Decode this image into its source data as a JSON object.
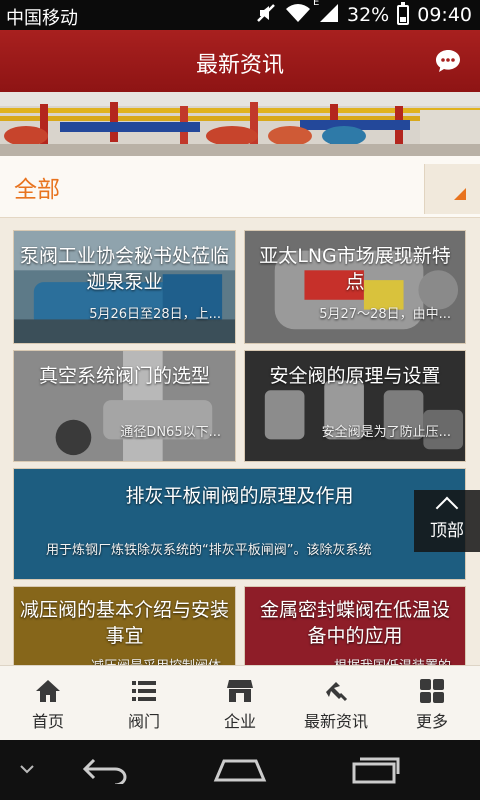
{
  "status": {
    "carrier": "中国移动",
    "network_letter": "E",
    "battery": "32%",
    "time": "09:40"
  },
  "header": {
    "title": "最新资讯"
  },
  "category": {
    "selected": "全部"
  },
  "articles": [
    {
      "title": "泵阀工业协会秘书处莅临迦泉泵业",
      "summary": "5月26日至28日，上..."
    },
    {
      "title": "亚太LNG市场展现新特点",
      "summary": "5月27～28日，由中..."
    },
    {
      "title": "真空系统阀门的选型",
      "summary": "通径DN65以下..."
    },
    {
      "title": "安全阀的原理与设置",
      "summary": "安全阀是为了防止压..."
    },
    {
      "title": "排灰平板闸阀的原理及作用",
      "summary": "用于炼钢厂炼铁除灰系统的“排灰平板闸阀”。该除灰系统"
    },
    {
      "title": "减压阀的基本介绍与安装事宜",
      "summary": "减压阀是采用控制阀体"
    },
    {
      "title": "金属密封蝶阀在低温设备中的应用",
      "summary": "根据我国低温装置的"
    }
  ],
  "back_to_top": "顶部",
  "bottom_nav": [
    {
      "label": "首页",
      "icon": "home-icon"
    },
    {
      "label": "阀门",
      "icon": "list-icon"
    },
    {
      "label": "企业",
      "icon": "store-icon"
    },
    {
      "label": "最新资讯",
      "icon": "news-icon"
    },
    {
      "label": "更多",
      "icon": "grid-icon"
    }
  ],
  "colors": {
    "header": "#a8201f",
    "accent": "#e8731e",
    "card_blue": "#1d5d80",
    "card_olive": "#86661a",
    "card_crimson": "#8e1d28"
  }
}
